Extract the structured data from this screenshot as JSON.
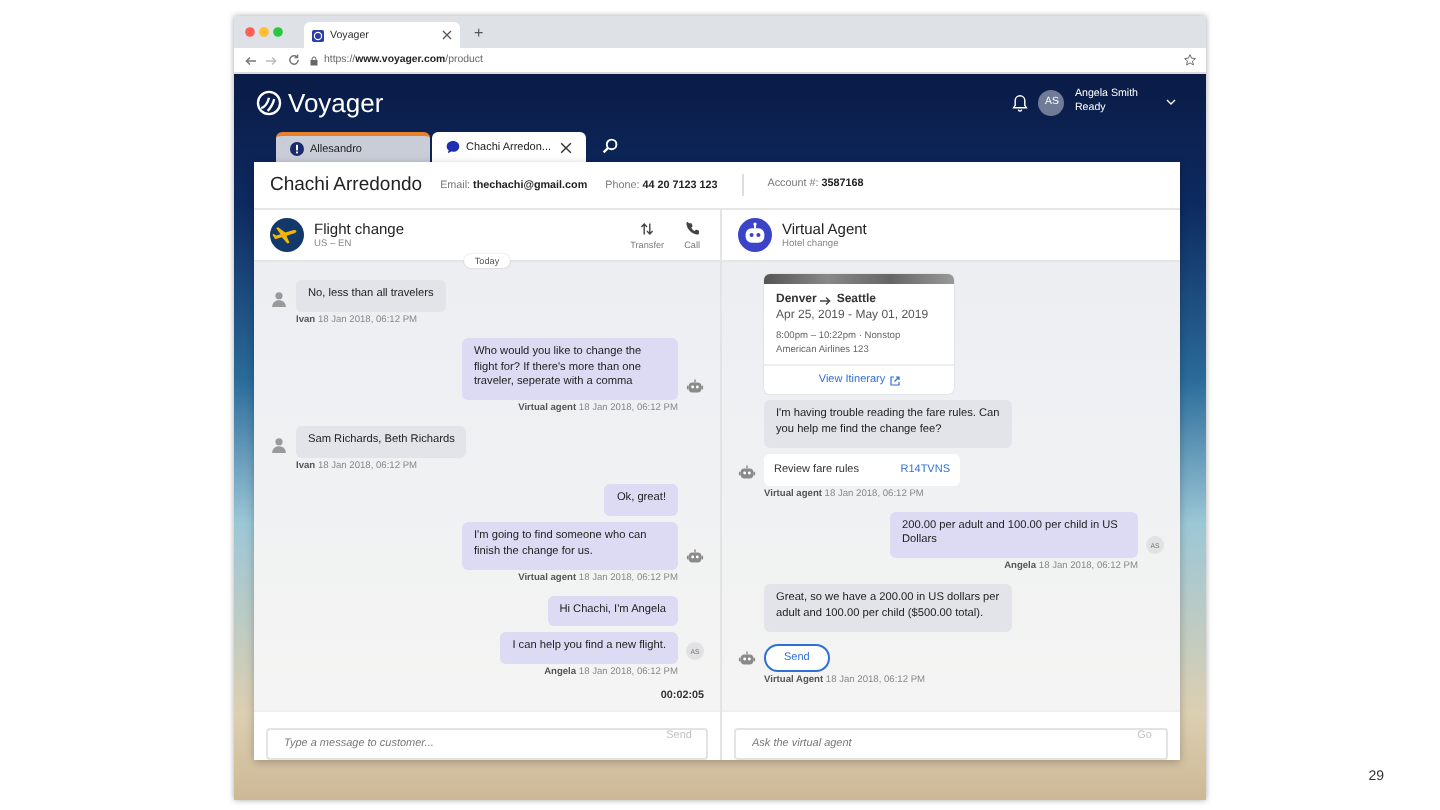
{
  "browser": {
    "tab_title": "Voyager",
    "new_tab": "+",
    "url": "https://**www.voyager.com**/product"
  },
  "app": {
    "logo": "Voyager",
    "user": {
      "initials": "AS",
      "name": "Angela Smith",
      "status": "Ready"
    }
  },
  "conversation_tabs": [
    {
      "label": "Allesandro",
      "kind": "alert",
      "selected": false,
      "attention": true
    },
    {
      "label": "Chachi Arredon...",
      "kind": "chat",
      "selected": true,
      "attention": false
    }
  ],
  "customer": {
    "name": "Chachi Arredondo",
    "fields": [
      "Email: **thechachi@gmail.com**",
      "Phone: **44 20 7123 123**",
      "Account #: **3587168**"
    ]
  },
  "customer_pane": {
    "title": "Flight change",
    "subtitle": "US – EN",
    "actions": [
      {
        "label": "Transfer",
        "kind": "transfer"
      },
      {
        "label": "Call",
        "kind": "call"
      }
    ],
    "date_divider": "Today",
    "messages": [
      {
        "kind": "incoming",
        "avatar": {
          "kind": "person"
        },
        "author": "Ivan",
        "time": "18 Jan 2018, 06:12 PM",
        "items": [
          {
            "kind": "bubble",
            "text": "No, less than all travelers"
          }
        ]
      },
      {
        "kind": "outgoing",
        "avatar": {
          "kind": "robot"
        },
        "author": "Virtual agent",
        "time": "18 Jan 2018, 06:12 PM",
        "items": [
          {
            "kind": "bubble",
            "text": "Who would you like to change the flight for? If there's more than one traveler, seperate with a comma"
          }
        ]
      },
      {
        "kind": "incoming",
        "avatar": {
          "kind": "person"
        },
        "author": "Ivan",
        "time": "18 Jan 2018, 06:12 PM",
        "items": [
          {
            "kind": "bubble",
            "text": "Sam Richards, Beth Richards"
          }
        ]
      },
      {
        "kind": "outgoing",
        "avatar": {
          "kind": "robot"
        },
        "author": "Virtual agent",
        "time": "18 Jan 2018, 06:12 PM",
        "items": [
          {
            "kind": "bubble",
            "text": "Ok, great!"
          },
          {
            "kind": "bubble",
            "text": "I'm going to find someone who can finish the change for us."
          }
        ]
      },
      {
        "kind": "outgoing",
        "avatar": {
          "kind": "initials",
          "text": "AS"
        },
        "author": "Angela",
        "time": "18 Jan 2018, 06:12 PM",
        "items": [
          {
            "kind": "bubble",
            "text": "Hi Chachi, I'm Angela"
          },
          {
            "kind": "bubble",
            "text": "I can help you find a new flight."
          }
        ]
      }
    ],
    "timer": "00:02:05",
    "composer": {
      "placeholder": "Type a message to customer...",
      "button": "Send",
      "button_disabled": true
    }
  },
  "agent_pane": {
    "title": "Virtual Agent",
    "subtitle": "Hotel change",
    "messages": [
      {
        "kind": "incoming",
        "avatar": {
          "kind": "robot"
        },
        "author": "Virtual agent",
        "time": "18 Jan 2018, 06:12 PM",
        "items": [
          {
            "kind": "itinerary",
            "route_from": "Denver",
            "route_to": "Seattle",
            "dates": "Apr 25, 2019 - May 01, 2019",
            "details": "8:00pm – 10:22pm · Nonstop",
            "flight": "American Airlines 123",
            "link": "View Itinerary"
          },
          {
            "kind": "bubble",
            "text": "I'm having trouble reading the fare rules. Can you help me find the change fee?"
          },
          {
            "kind": "link_card",
            "label": "Review fare rules",
            "code": "R14TVNS"
          }
        ]
      },
      {
        "kind": "outgoing",
        "avatar": {
          "kind": "initials",
          "text": "AS"
        },
        "author": "Angela",
        "time": "18 Jan 2018, 06:12 PM",
        "items": [
          {
            "kind": "bubble",
            "text": "200.00 per adult and 100.00 per child in US Dollars"
          }
        ]
      },
      {
        "kind": "incoming",
        "avatar": {
          "kind": "robot"
        },
        "author": "Virtual Agent",
        "time": "18 Jan 2018, 06:12 PM",
        "items": [
          {
            "kind": "bubble",
            "text": "Great, so we have a 200.00 in US dollars per adult and 100.00 per child ($500.00 total)."
          },
          {
            "kind": "button",
            "label": "Send"
          }
        ]
      }
    ],
    "composer": {
      "placeholder": "Ask the virtual agent",
      "button": "Go",
      "button_disabled": true
    }
  },
  "page_number": "29"
}
